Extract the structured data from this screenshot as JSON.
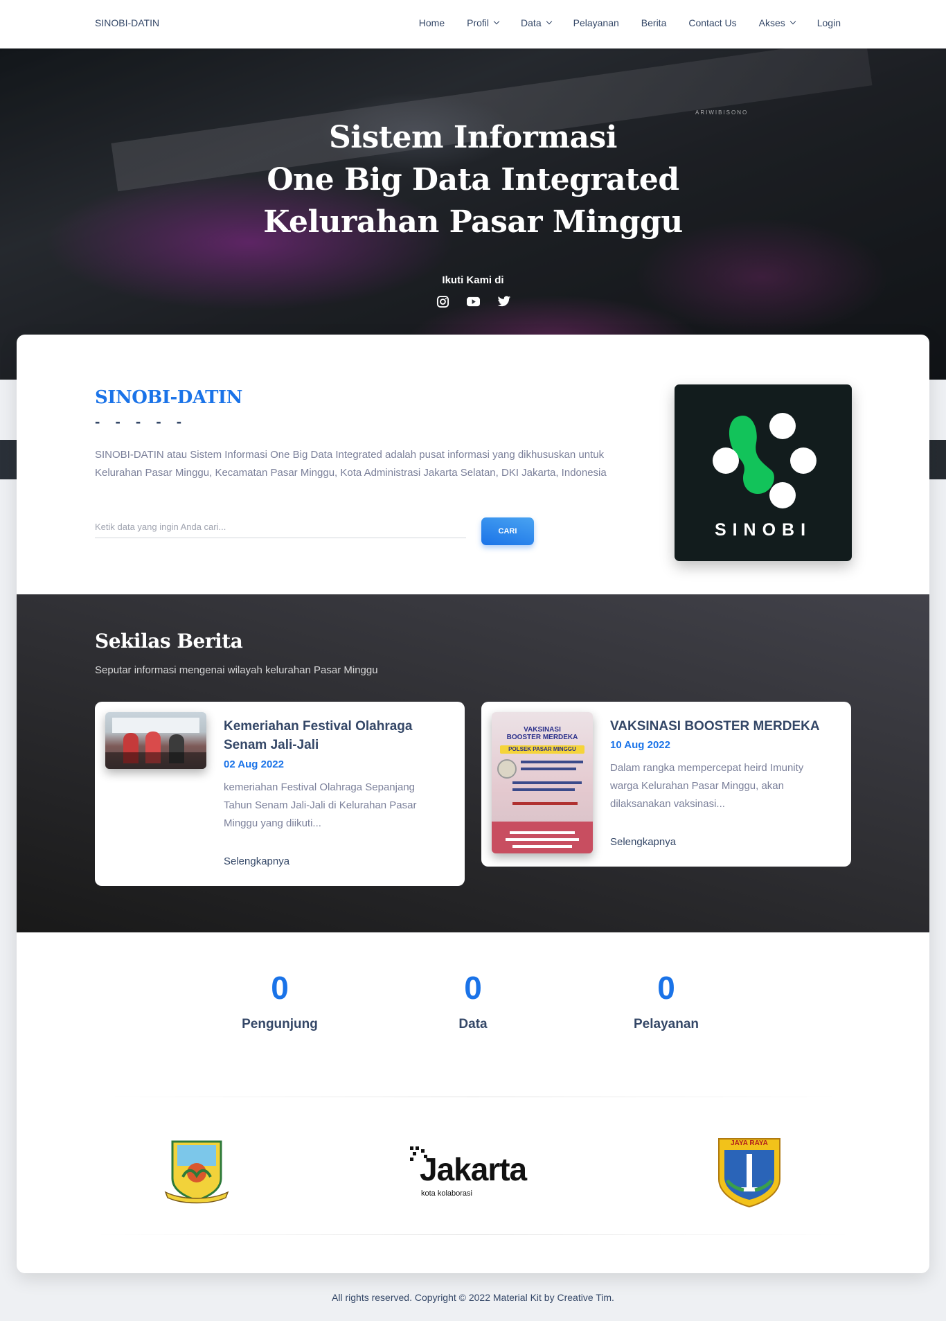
{
  "navbar": {
    "brand": "SINOBI-DATIN",
    "items": [
      "Home",
      "Profil",
      "Data",
      "Pelayanan",
      "Berita",
      "Contact Us",
      "Akses",
      "Login"
    ]
  },
  "hero": {
    "watermark": "ARIWIBISONO",
    "title_lines": [
      "Sistem Informasi",
      "One Big Data Integrated",
      "Kelurahan Pasar Minggu"
    ],
    "follow_label": "Ikuti Kami di",
    "socials": [
      "instagram-icon",
      "youtube-icon",
      "twitter-icon"
    ]
  },
  "about": {
    "title": "SINOBI-DATIN",
    "dashes": "- - - - -",
    "description": "SINOBI-DATIN atau Sistem Informasi One Big Data Integrated adalah pusat informasi yang dikhususkan untuk Kelurahan Pasar Minggu, Kecamatan Pasar Minggu, Kota Administrasi Jakarta Selatan, DKI Jakarta, Indonesia",
    "search_placeholder": "Ketik data yang ingin Anda cari...",
    "search_button": "CARI",
    "logo_text": "SINOBI"
  },
  "news": {
    "title": "Sekilas Berita",
    "subtitle": "Seputar informasi mengenai wilayah kelurahan Pasar Minggu",
    "items": [
      {
        "title": "Kemeriahan Festival Olahraga Senam Jali-Jali",
        "date": "02 Aug 2022",
        "desc": "kemeriahan Festival Olahraga Sepanjang Tahun Senam Jali-Jali di Kelurahan Pasar Minggu yang diikuti...",
        "more": "Selengkapnya"
      },
      {
        "title": "VAKSINASI BOOSTER MERDEKA",
        "date": "10 Aug 2022",
        "desc": "Dalam rangka mempercepat heird Imunity warga Kelurahan Pasar Minggu, akan dilaksanakan vaksinasi...",
        "more": "Selengkapnya",
        "poster_lines": [
          "VAKSINASI",
          "BOOSTER MERDEKA",
          "POLSEK PASAR MINGGU"
        ]
      }
    ]
  },
  "stats": [
    {
      "value": "0",
      "label": "Pengunjung"
    },
    {
      "value": "0",
      "label": "Data"
    },
    {
      "value": "0",
      "label": "Pelayanan"
    }
  ],
  "partners": {
    "jakarta_word": "Jakarta",
    "jakarta_tagline": "kota kolaborasi",
    "dki_banner": "JAYA RAYA"
  },
  "footer": "All rights reserved. Copyright © 2022 Material Kit by Creative Tim.",
  "colors": {
    "accent": "#1A73E8",
    "text": "#344767",
    "muted": "#7b809a"
  }
}
